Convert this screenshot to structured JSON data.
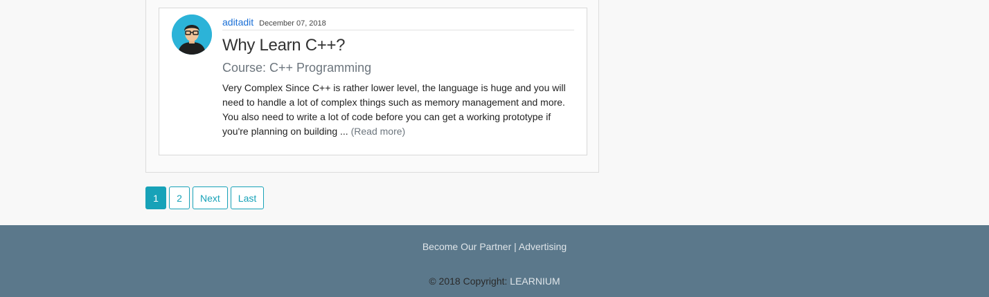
{
  "post": {
    "author": "aditadit",
    "date": "December 07, 2018",
    "title": "Why Learn C++?",
    "course": "Course: C++ Programming",
    "excerpt": "Very Complex Since C++ is rather lower level, the language is huge and you will need to handle a lot of complex things such as memory management and more. You also need to write a lot of code before you can get a working prototype if you're planning on building ... ",
    "read_more": "(Read more)"
  },
  "pagination": {
    "pages": [
      "1",
      "2"
    ],
    "next": "Next",
    "last": "Last",
    "current": "1"
  },
  "footer": {
    "partner": "Become Our Partner",
    "separator": "|",
    "advertising": "Advertising",
    "copyright": "© 2018 Copyright:",
    "brand": "LEARNIUM"
  },
  "colors": {
    "accent": "#17a2b8",
    "footer_bg": "#5b788b",
    "author_link": "#1a6fd6"
  },
  "icons": {
    "avatar": "user-avatar-icon"
  }
}
